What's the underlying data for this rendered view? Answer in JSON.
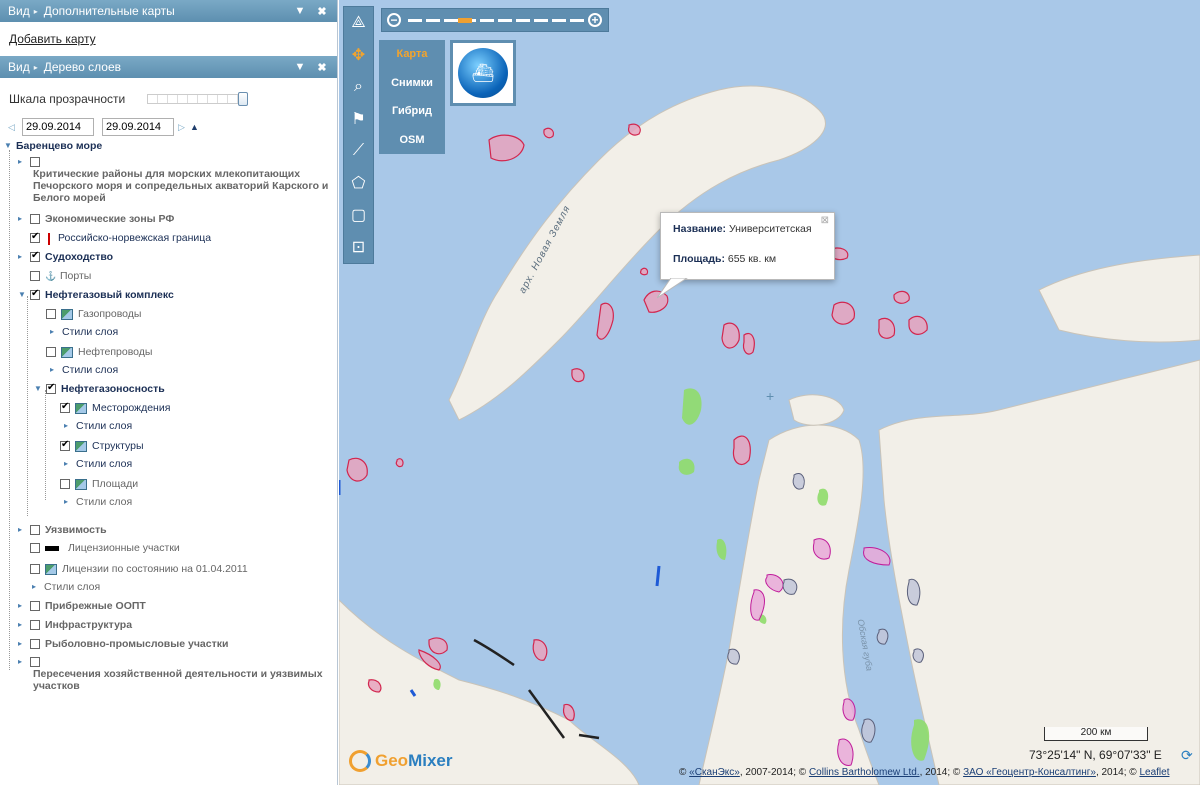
{
  "panels": {
    "extra_maps": {
      "vid": "Вид",
      "title": "Дополнительные карты",
      "collapse": "▼",
      "close": "✖"
    },
    "add_map_link": "Добавить карту",
    "layer_tree": {
      "vid": "Вид",
      "title": "Дерево слоев",
      "collapse": "▼",
      "close": "✖"
    }
  },
  "transparency": {
    "label": "Шкала прозрачности",
    "value_percent": 100
  },
  "dates": {
    "from": "29.09.2014",
    "to": "29.09.2014"
  },
  "tree": {
    "root": "Баренцево море",
    "n1": "Критические районы для морских млекопитающих Печорского моря и сопредельных акваторий Карского и Белого морей",
    "n2": "Экономические зоны РФ",
    "n3": "Российско-норвежская граница",
    "n4": "Судоходство",
    "n5": "Порты",
    "n6": "Нефтегазовый комплекс",
    "n7": "Газопроводы",
    "s1": "Стили слоя",
    "n8": "Нефтепроводы",
    "s2": "Стили слоя",
    "n9": "Нефтегазоносность",
    "n10": "Месторождения",
    "s3": "Стили слоя",
    "n11": "Структуры",
    "s4": "Стили слоя",
    "n12": "Площади",
    "s5": "Стили слоя",
    "n13": "Уязвимость",
    "n14": "Лицензионные участки",
    "n15": "Лицензии по состоянию на 01.04.2011",
    "s6": "Стили слоя",
    "n16": "Прибрежные ООПТ",
    "n17": "Инфраструктура",
    "n18": "Рыболовно-промысловые участки",
    "n19": "Пересечения хозяйственной деятельности и уязвимых участков"
  },
  "map": {
    "basemaps": [
      "Карта",
      "Снимки",
      "Гибрид",
      "OSM"
    ],
    "active_basemap": "Карта",
    "tools": [
      "pan-icon",
      "search-icon",
      "flag-icon",
      "polyline-icon",
      "polygon-icon",
      "rectangle-icon",
      "route-icon"
    ],
    "zoom": {
      "minus": "−",
      "plus": "+"
    },
    "popup": {
      "name_label": "Название:",
      "name_value": "Университетская",
      "area_label": "Площадь:",
      "area_value": "655 кв. км",
      "close": "⊠"
    },
    "labels": {
      "novaya_zemlya": "арх. Новая Земля",
      "ob_bay": "Обская губа"
    },
    "scale": "200 км",
    "coordinates": "73°25'14\" N, 69°07'33\" E",
    "logo_geo": "Geo",
    "logo_mixer": "Mixer",
    "copyright": [
      {
        "text": "© ",
        "link": false
      },
      {
        "text": "«СканЭкс»",
        "link": true
      },
      {
        "text": ", 2007-2014; © ",
        "link": false
      },
      {
        "text": "Collins Bartholomew Ltd.",
        "link": true
      },
      {
        "text": ", 2014; © ",
        "link": false
      },
      {
        "text": "ЗАО «Геоцентр-Консалтинг»",
        "link": true
      },
      {
        "text": ", 2014; © ",
        "link": false
      },
      {
        "text": "Leaflet",
        "link": true
      }
    ],
    "colors": {
      "sea": "#a9c8e8",
      "land": "#f2efe8",
      "area_fill": "#e7a3bd",
      "area_stroke": "#d2264e",
      "field_fill": "#8fdc6a",
      "structure_fill": "#e9a9d8",
      "structure_stroke": "#c01c9b",
      "license_fill": "#c2c6d8",
      "license_stroke": "#5a5f7a",
      "panel_blue": "#5f8eb0",
      "accent_orange": "#f3a42d"
    }
  }
}
